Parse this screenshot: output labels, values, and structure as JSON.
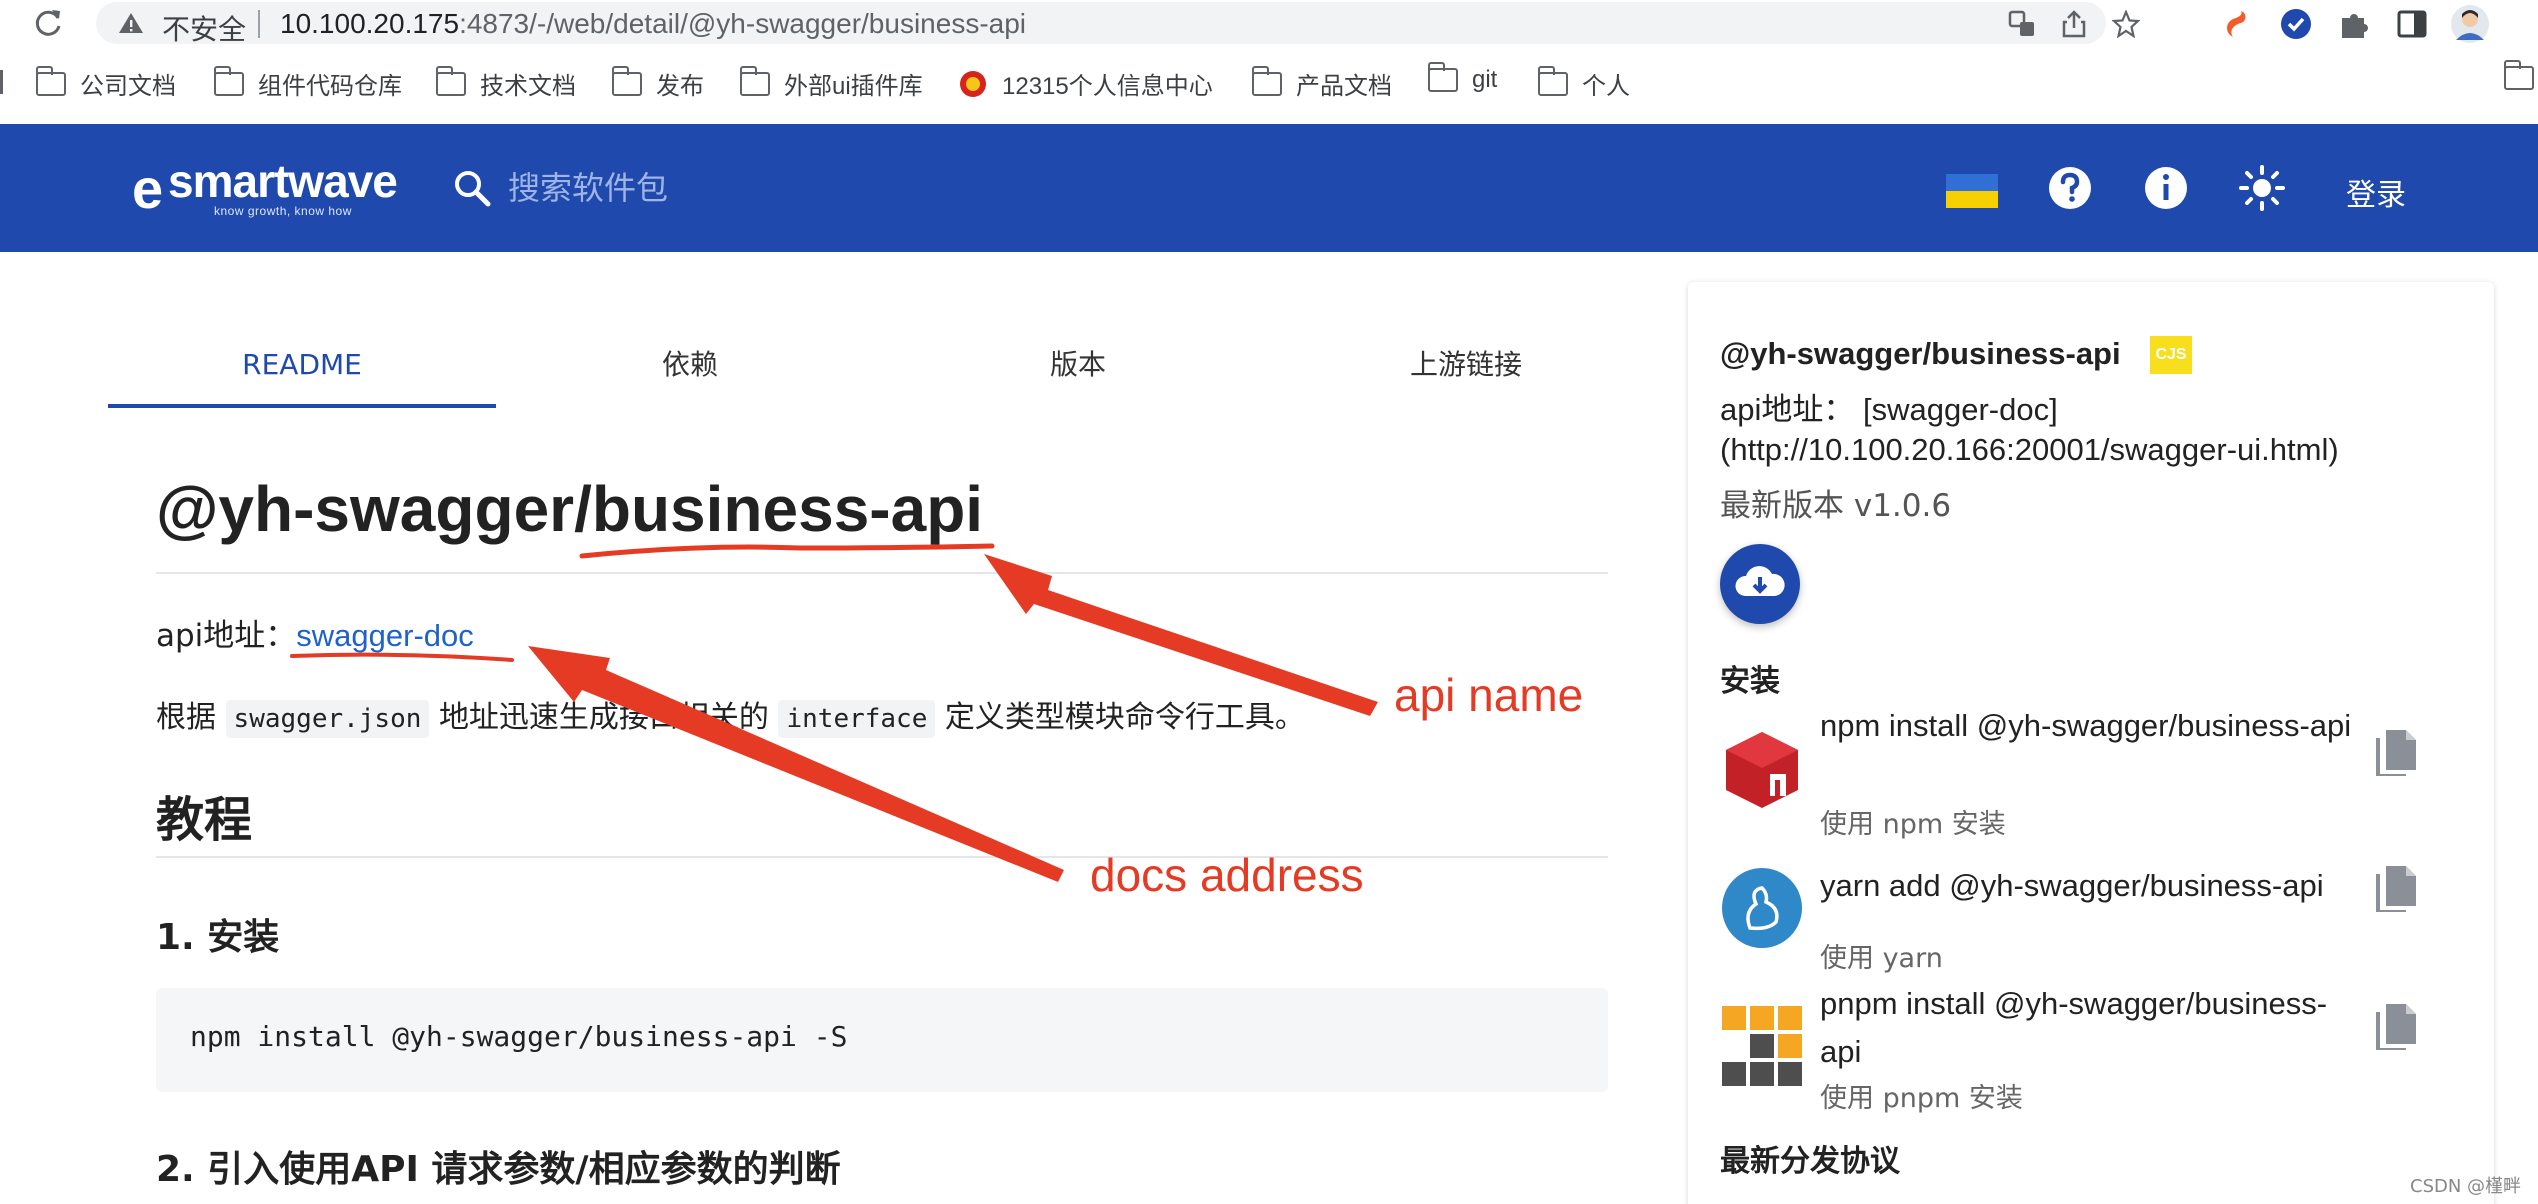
{
  "browser": {
    "security_label": "不安全",
    "url_host": "10.100.20.175",
    "url_path": ":4873/-/web/detail/@yh-swagger/business-api"
  },
  "bookmarks": [
    "公司文档",
    "组件代码仓库",
    "技术文档",
    "发布",
    "外部ui插件库",
    "12315个人信息中心",
    "产品文档",
    "git",
    "个人"
  ],
  "header": {
    "logo_text": "smartwave",
    "logo_tagline": "know growth, know how",
    "search_placeholder": "搜索软件包",
    "login_label": "登录"
  },
  "tabs": [
    "README",
    "依赖",
    "版本",
    "上游链接"
  ],
  "readme": {
    "title": "@yh-swagger/business-api",
    "api_label": "api地址：",
    "api_link": "swagger-doc",
    "desc_prefix": "根据",
    "desc_code1": "swagger.json",
    "desc_mid": "地址迅速生成接口相关的",
    "desc_code2": "interface",
    "desc_suffix": "定义类型模块命令行工具。",
    "h2_tutorial": "教程",
    "h3_install": "1. 安装",
    "install_cmd": "npm install @yh-swagger/business-api -S",
    "h3_usage": "2. 引入使用API 请求参数/相应参数的判断"
  },
  "sidebar": {
    "package_name": "@yh-swagger/business-api",
    "badge": "CJS",
    "api_line1": "api地址：  [swagger-doc]",
    "api_line2": "(http://10.100.20.166:20001/swagger-ui.html)",
    "latest_version": "最新版本 v1.0.6",
    "install_heading": "安装",
    "installs": [
      {
        "cmd": "npm install @yh-swagger/business-api",
        "sub": "使用 npm 安装"
      },
      {
        "cmd": "yarn add @yh-swagger/business-api",
        "sub": "使用 yarn"
      },
      {
        "cmd": "pnpm install @yh-swagger/business-api",
        "sub": "使用 pnpm 安装"
      }
    ],
    "license_heading": "最新分发协议"
  },
  "annotations": {
    "api_name": "api name",
    "docs_address": "docs address"
  },
  "watermark": "CSDN @槿畔",
  "colors": {
    "header_bg": "#1f49ac",
    "link": "#1f63c9",
    "annotation": "#e53b25",
    "cjs_badge": "#f7df1e"
  }
}
